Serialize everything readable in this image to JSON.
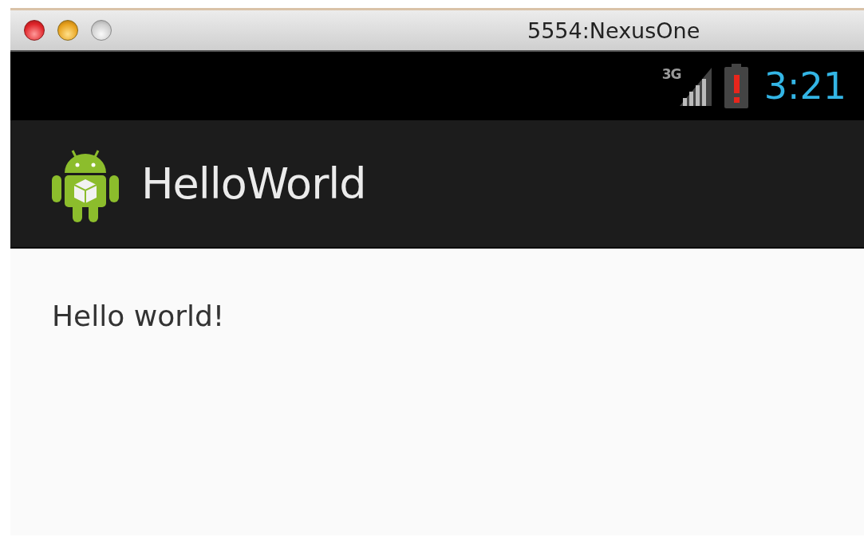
{
  "window": {
    "title": "5554:NexusOne"
  },
  "status_bar": {
    "network": "3G",
    "time": "3:21"
  },
  "action_bar": {
    "title": "HelloWorld"
  },
  "content": {
    "text": "Hello world!"
  }
}
